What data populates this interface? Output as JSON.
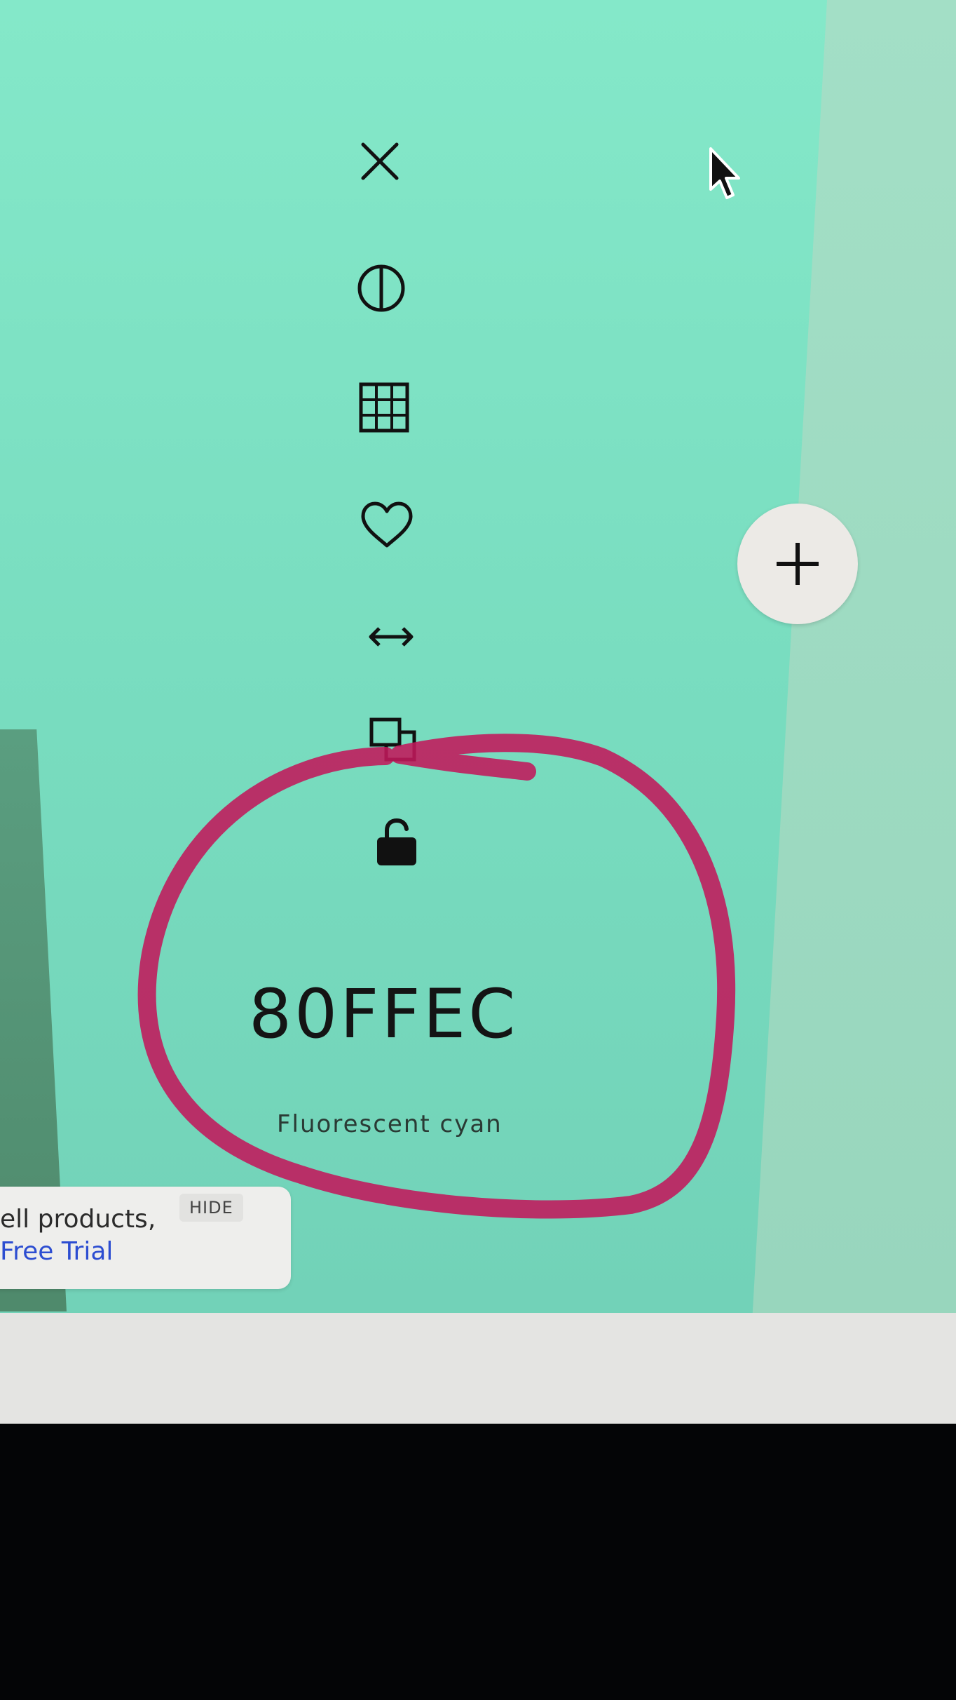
{
  "swatch": {
    "hex": "80FFEC",
    "name": "Fluorescent cyan",
    "color": "#80FFEC"
  },
  "toolbar": {
    "icons": [
      "close-icon",
      "contrast-icon",
      "grid-icon",
      "heart-icon",
      "resize-horizontal-icon",
      "duplicate-icon",
      "unlock-icon"
    ]
  },
  "add_button": {
    "icon": "plus-icon"
  },
  "promo": {
    "line1": "ell products,",
    "link": "Free Trial",
    "hide_label": "HIDE"
  },
  "annotation": {
    "color": "#c2185b"
  }
}
